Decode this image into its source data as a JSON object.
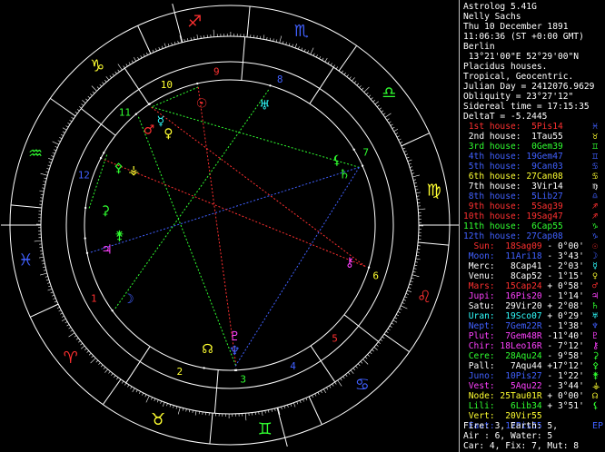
{
  "window": {
    "title": "Astrolog 5.41G"
  },
  "info": {
    "name": "Nelly Sachs",
    "date": "Thu 10 December 1891",
    "time": "11:06:36 (ST +0:00 GMT)",
    "place": "Berlin",
    "coords": " 13°21'00\"E 52°29'00\"N",
    "house_system": "Placidus houses.",
    "zodiac": "Tropical, Geocentric.",
    "julian": "Julian Day = 2412076.9629",
    "obliquity": "Obliquity = 23°27'12\"",
    "sidereal": "Sidereal time = 17:15:35",
    "delta_t": "DeltaT = -5.2445"
  },
  "houses": [
    {
      "label": "1st house:",
      "value": "5Pis14",
      "color": "#ff3030",
      "glyph": "♓",
      "gcolor": "#4060ff"
    },
    {
      "label": "2nd house:",
      "value": "1Tau55",
      "color": "#ffffff",
      "glyph": "♉",
      "gcolor": "#ffff30"
    },
    {
      "label": "3rd house:",
      "value": "0Gem39",
      "color": "#30ff30",
      "glyph": "♊",
      "gcolor": "#30ff30"
    },
    {
      "label": "4th house:",
      "value": "19Gem47",
      "color": "#4060ff",
      "glyph": "♊",
      "gcolor": "#4060ff"
    },
    {
      "label": "5th house:",
      "value": "9Can03",
      "color": "#4060ff",
      "glyph": "♋",
      "gcolor": "#4060ff"
    },
    {
      "label": "6th house:",
      "value": "27Can08",
      "color": "#ffff30",
      "glyph": "♋",
      "gcolor": "#ffff30"
    },
    {
      "label": "7th house:",
      "value": "3Vir14",
      "color": "#ffffff",
      "glyph": "♍",
      "gcolor": "#ffffff"
    },
    {
      "label": "8th house:",
      "value": "5Lib27",
      "color": "#4060ff",
      "glyph": "♎",
      "gcolor": "#4060ff"
    },
    {
      "label": "9th house:",
      "value": "5Sag39",
      "color": "#ff3030",
      "glyph": "♐",
      "gcolor": "#ff3030"
    },
    {
      "label": "10th house:",
      "value": "19Sag47",
      "color": "#ff3030",
      "glyph": "♐",
      "gcolor": "#ff3030"
    },
    {
      "label": "11th house:",
      "value": "6Cap55",
      "color": "#30ff30",
      "glyph": "♑",
      "gcolor": "#30ff30"
    },
    {
      "label": "12th house:",
      "value": "27Cap08",
      "color": "#4060ff",
      "glyph": "♑",
      "gcolor": "#4060ff"
    }
  ],
  "planets": [
    {
      "name": "Sun:",
      "pos": "18Sag09",
      "lat": "- 0°00'",
      "color": "#ff3030",
      "glyph": "☉",
      "gcolor": "#ff3030"
    },
    {
      "name": "Moon:",
      "pos": "11Ari18",
      "lat": "- 3°43'",
      "color": "#4060ff",
      "glyph": "☽",
      "gcolor": "#4060ff"
    },
    {
      "name": "Merc:",
      "pos": "8Cap41",
      "lat": "- 2°03'",
      "color": "#ffffff",
      "glyph": "☿",
      "gcolor": "#30ffff"
    },
    {
      "name": "Venu:",
      "pos": "8Cap52",
      "lat": "- 1°15'",
      "color": "#ffffff",
      "glyph": "♀",
      "gcolor": "#ffff30"
    },
    {
      "name": "Mars:",
      "pos": "15Cap24",
      "lat": "+ 0°58'",
      "color": "#ff3030",
      "glyph": "♂",
      "gcolor": "#ff3030"
    },
    {
      "name": "Jupi:",
      "pos": "16Pis20",
      "lat": "- 1°14'",
      "color": "#ff40ff",
      "glyph": "♃",
      "gcolor": "#ff40ff"
    },
    {
      "name": "Satu:",
      "pos": "29Vir20",
      "lat": "+ 2°08'",
      "color": "#ffffff",
      "glyph": "♄",
      "gcolor": "#30ff30"
    },
    {
      "name": "Uran:",
      "pos": "19Sco07",
      "lat": "+ 0°29'",
      "color": "#30ffff",
      "glyph": "♅",
      "gcolor": "#30ffff"
    },
    {
      "name": "Nept:",
      "pos": "7Gem22R",
      "lat": "- 1°38'",
      "color": "#4060ff",
      "glyph": "♆",
      "gcolor": "#4060ff"
    },
    {
      "name": "Plut:",
      "pos": "7Gem48R",
      "lat": "-11°40'",
      "color": "#ff40ff",
      "glyph": "♇",
      "gcolor": "#ff40ff"
    },
    {
      "name": "Chir:",
      "pos": "18Leo16R",
      "lat": "- 7°12'",
      "color": "#ff40ff",
      "glyph": "⚷",
      "gcolor": "#ff40ff"
    },
    {
      "name": "Cere:",
      "pos": "28Aqu24",
      "lat": "- 9°58'",
      "color": "#30ff30",
      "glyph": "⚳",
      "gcolor": "#30ff30"
    },
    {
      "name": "Pall:",
      "pos": "7Aqu44",
      "lat": "+17°12'",
      "color": "#ffffff",
      "glyph": "⚴",
      "gcolor": "#30ff30"
    },
    {
      "name": "Juno:",
      "pos": "10Pis27",
      "lat": "- 1°22'",
      "color": "#4060ff",
      "glyph": "⚵",
      "gcolor": "#30ff30"
    },
    {
      "name": "Vest:",
      "pos": "5Aqu22",
      "lat": "- 3°44'",
      "color": "#ff40ff",
      "glyph": "⚶",
      "gcolor": "#ffff30"
    },
    {
      "name": "Node:",
      "pos": "25Tau01R",
      "lat": "+ 0°00'",
      "color": "#ffff30",
      "glyph": "☊",
      "gcolor": "#ffff30"
    },
    {
      "name": "Lili:",
      "pos": "6Lib34",
      "lat": "+ 3°51'",
      "color": "#30ff30",
      "glyph": "⚸",
      "gcolor": "#30ff30"
    },
    {
      "name": "Vert:",
      "pos": "20Vir55",
      "lat": "",
      "color": "#ffff30",
      "glyph": "",
      "gcolor": "#ffff30"
    },
    {
      "name": "East:",
      "pos": "17Pis55",
      "lat": "",
      "color": "#4060ff",
      "glyph": "EP",
      "gcolor": "#4060ff"
    }
  ],
  "elements": {
    "line1": "Fire: 3, Earth: 5,",
    "line2": "Air : 6, Water: 5",
    "line3": "Car: 4, Fix: 7, Mut: 8"
  },
  "wheel": {
    "signs": [
      {
        "glyph": "♐",
        "color": "#ff3030"
      },
      {
        "glyph": "♑",
        "color": "#ffff30"
      },
      {
        "glyph": "♒",
        "color": "#30ff30"
      },
      {
        "glyph": "♓",
        "color": "#4060ff"
      },
      {
        "glyph": "♈",
        "color": "#ff3030"
      },
      {
        "glyph": "♉",
        "color": "#ffff30"
      },
      {
        "glyph": "♊",
        "color": "#30ff30"
      },
      {
        "glyph": "♋",
        "color": "#4060ff"
      },
      {
        "glyph": "♌",
        "color": "#ff3030"
      },
      {
        "glyph": "♍",
        "color": "#ffff30"
      },
      {
        "glyph": "♎",
        "color": "#30ff30"
      },
      {
        "glyph": "♏",
        "color": "#4060ff"
      }
    ],
    "house_numbers": [
      "1",
      "2",
      "3",
      "4",
      "5",
      "6",
      "7",
      "8",
      "9",
      "10",
      "11",
      "12"
    ]
  }
}
